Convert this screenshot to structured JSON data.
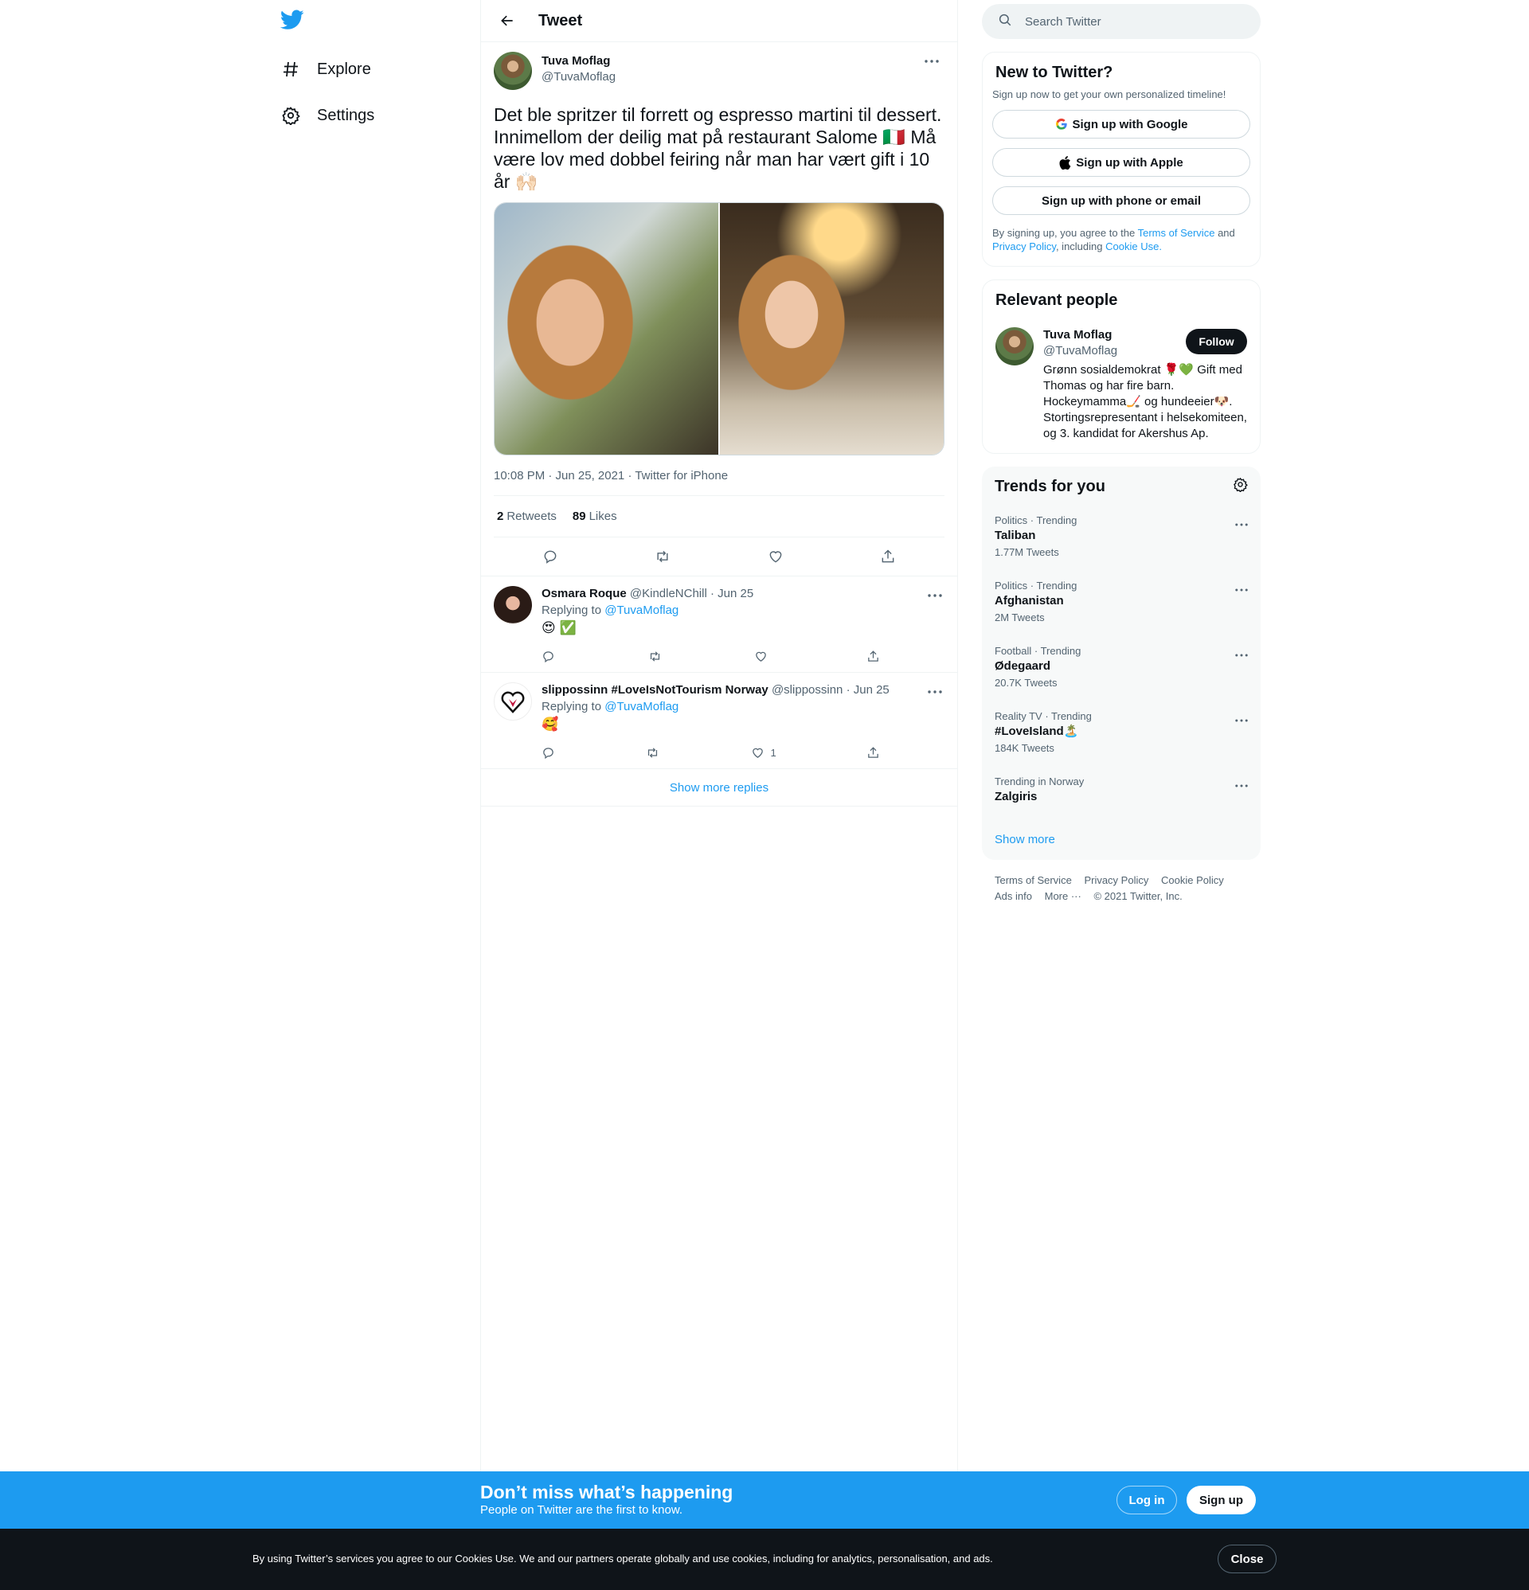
{
  "nav": {
    "explore_label": "Explore",
    "settings_label": "Settings"
  },
  "header": {
    "title": "Tweet"
  },
  "tweet": {
    "author_name": "Tuva Moflag",
    "author_handle": "@TuvaMoflag",
    "text": "Det ble spritzer til forrett og espresso martini til dessert. Innimellom der deilig mat på restaurant Salome 🇮🇹 Må være lov med dobbel feiring når man har vært gift i 10 år 🙌🏻",
    "timestamp": "10:08 PM · Jun 25, 2021 · Twitter for iPhone",
    "retweets_count": "2",
    "retweets_label": "Retweets",
    "likes_count": "89",
    "likes_label": "Likes"
  },
  "replies": [
    {
      "name": "Osmara Roque",
      "handle": "@KindleNChill",
      "date": "· Jun 25",
      "replying_prefix": "Replying to",
      "replying_to": "@TuvaMoflag",
      "text": "😍 ✅",
      "like_count": ""
    },
    {
      "name": "slippossinn #LoveIsNotTourism Norway",
      "handle": "@slippossinn",
      "date": "· Jun 25",
      "replying_prefix": "Replying to",
      "replying_to": "@TuvaMoflag",
      "text": "🥰",
      "like_count": "1"
    }
  ],
  "show_more_replies": "Show more replies",
  "search": {
    "placeholder": "Search Twitter"
  },
  "new_to_twitter": {
    "title": "New to Twitter?",
    "subtitle": "Sign up now to get your own personalized timeline!",
    "google": "Sign up with Google",
    "apple": "Sign up with Apple",
    "phone": "Sign up with phone or email",
    "terms_1": "By signing up, you agree to the",
    "terms_link": "Terms of Service",
    "terms_2": "and",
    "privacy_link": "Privacy Policy",
    "terms_3": ", including",
    "cookie_link": "Cookie Use."
  },
  "relevant": {
    "title": "Relevant people",
    "name": "Tuva Moflag",
    "handle": "@TuvaMoflag",
    "follow_label": "Follow",
    "bio": "Grønn sosialdemokrat 🌹💚 Gift med Thomas og har fire barn. Hockeymamma🏒 og hundeeier🐶. Stortingsrepresentant i helsekomiteen, og 3. kandidat for Akershus Ap."
  },
  "trends": {
    "title": "Trends for you",
    "items": [
      {
        "context": "Politics · Trending",
        "name": "Taliban",
        "count": "1.77M Tweets"
      },
      {
        "context": "Politics · Trending",
        "name": "Afghanistan",
        "count": "2M Tweets"
      },
      {
        "context": "Football · Trending",
        "name": "Ødegaard",
        "count": "20.7K Tweets"
      },
      {
        "context": "Reality TV · Trending",
        "name": "#LoveIsland🏝️",
        "count": "184K Tweets"
      },
      {
        "context": "Trending in Norway",
        "name": "Zalgiris",
        "count": ""
      }
    ],
    "show_more": "Show more"
  },
  "footer": {
    "terms": "Terms of Service",
    "privacy": "Privacy Policy",
    "cookie": "Cookie Policy",
    "ads": "Ads info",
    "more": "More ···",
    "copyright": "© 2021 Twitter, Inc."
  },
  "banner": {
    "heading": "Don’t miss what’s happening",
    "sub": "People on Twitter are the first to know.",
    "login": "Log in",
    "signup": "Sign up"
  },
  "cookie_bar": {
    "text": "By using Twitter’s services you agree to our Cookies Use. We and our partners operate globally and use cookies, including for analytics, personalisation, and ads.",
    "close": "Close"
  },
  "colors": {
    "accent": "#1d9bf0",
    "text": "#0f1419",
    "secondary": "#536471",
    "border": "#eff3f4"
  }
}
